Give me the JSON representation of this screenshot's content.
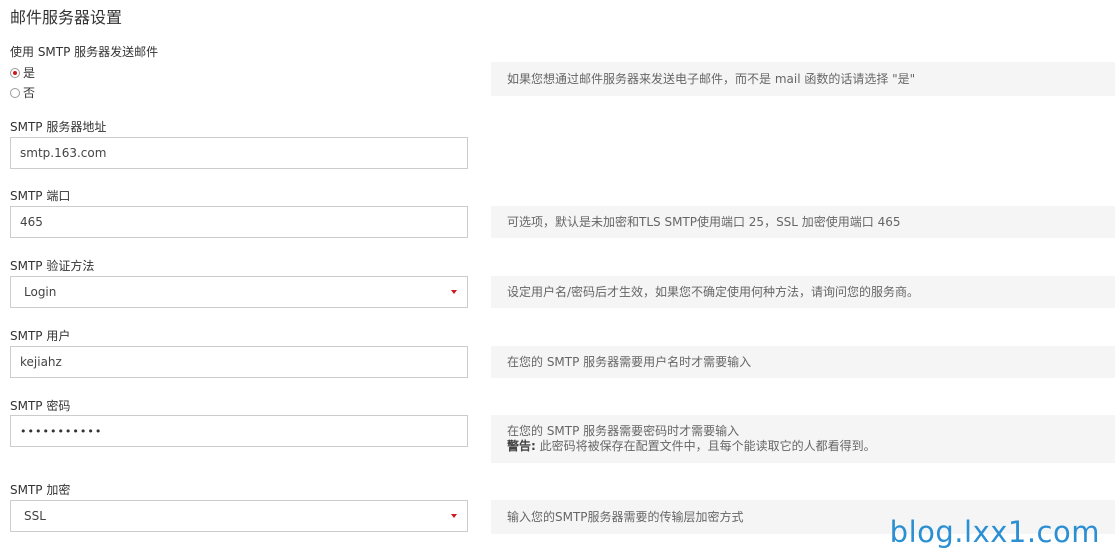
{
  "page": {
    "title": "邮件服务器设置"
  },
  "use_smtp": {
    "label": "使用 SMTP 服务器发送邮件",
    "options": [
      {
        "label": "是",
        "checked": true
      },
      {
        "label": "否",
        "checked": false
      }
    ],
    "help": "如果您想通过邮件服务器来发送电子邮件，而不是 mail 函数的话请选择 \"是\""
  },
  "smtp_host": {
    "label": "SMTP 服务器地址",
    "value": "smtp.163.com"
  },
  "smtp_port": {
    "label": "SMTP 端口",
    "value": "465",
    "help": "可选项，默认是未加密和TLS SMTP使用端口 25，SSL 加密使用端口 465"
  },
  "smtp_auth": {
    "label": "SMTP 验证方法",
    "value": "Login",
    "help": "设定用户名/密码后才生效，如果您不确定使用何种方法，请询问您的服务商。"
  },
  "smtp_user": {
    "label": "SMTP 用户",
    "value": "kejiahz",
    "help": "在您的 SMTP 服务器需要用户名时才需要输入"
  },
  "smtp_pass": {
    "label": "SMTP 密码",
    "value": "•••••••••••",
    "help": "在您的 SMTP 服务器需要密码时才需要输入",
    "warning_label": "警告:",
    "warning_text": " 此密码将被保存在配置文件中，且每个能读取它的人都看得到。"
  },
  "smtp_encryption": {
    "label": "SMTP 加密",
    "value": "SSL",
    "help": "输入您的SMTP服务器需要的传输层加密方式"
  },
  "watermark": "blog.lxx1.com",
  "colors": {
    "accent": "#d0191e",
    "help_bg": "#f5f5f5",
    "watermark": "#2b8fd3"
  }
}
